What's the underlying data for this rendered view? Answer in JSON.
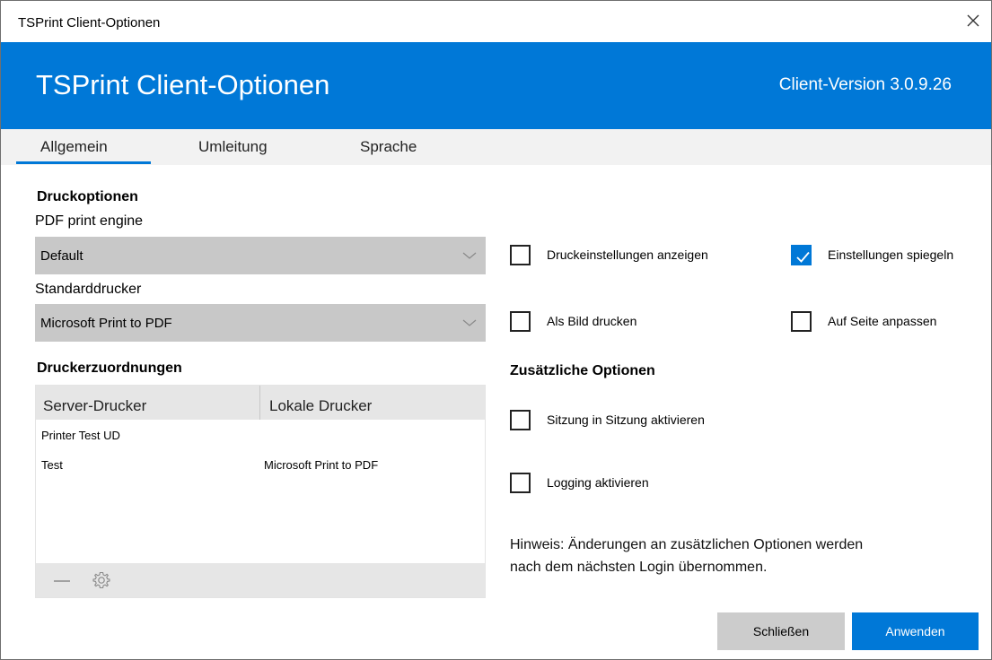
{
  "window": {
    "title": "TSPrint Client-Optionen"
  },
  "header": {
    "title": "TSPrint Client-Optionen",
    "version": "Client-Version 3.0.9.26"
  },
  "tabs": [
    {
      "label": "Allgemein",
      "active": true
    },
    {
      "label": "Umleitung",
      "active": false
    },
    {
      "label": "Sprache",
      "active": false
    }
  ],
  "print_options": {
    "section_title": "Druckoptionen",
    "engine_label": "PDF print engine",
    "engine_value": "Default",
    "default_printer_label": "Standarddrucker",
    "default_printer_value": "Microsoft Print to PDF"
  },
  "mappings": {
    "section_title": "Druckerzuordnungen",
    "columns": [
      "Server-Drucker",
      "Lokale Drucker"
    ],
    "rows": [
      [
        "Printer Test UD",
        ""
      ],
      [
        "Test",
        "Microsoft Print to PDF"
      ]
    ]
  },
  "checkboxes": {
    "show_print_settings": {
      "label": "Druckeinstellungen anzeigen",
      "checked": false
    },
    "mirror_settings": {
      "label": "Einstellungen spiegeln",
      "checked": true
    },
    "print_as_image": {
      "label": "Als Bild drucken",
      "checked": false
    },
    "fit_to_page": {
      "label": "Auf Seite anpassen",
      "checked": false
    }
  },
  "additional": {
    "section_title": "Zusätzliche Optionen",
    "session_in_session": {
      "label": "Sitzung in Sitzung aktivieren",
      "checked": false
    },
    "logging": {
      "label": "Logging aktivieren",
      "checked": false
    },
    "note_line1": "Hinweis: Änderungen an zusätzlichen Optionen werden",
    "note_line2": "nach dem nächsten Login übernommen."
  },
  "buttons": {
    "close": "Schließen",
    "apply": "Anwenden"
  },
  "colors": {
    "accent": "#0078d7",
    "select_bg": "#c8c8c8",
    "table_header_bg": "#e6e6e6"
  }
}
